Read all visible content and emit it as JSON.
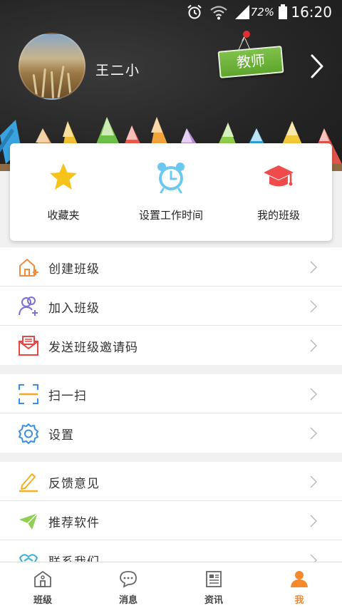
{
  "status_bar": {
    "battery_percent": "72%",
    "time": "16:20"
  },
  "profile": {
    "name": "王二小",
    "role": "教师"
  },
  "quick_actions": [
    {
      "label": "收藏夹",
      "icon": "star-icon",
      "color": "#f7c21a"
    },
    {
      "label": "设置工作时间",
      "icon": "alarm-clock-icon",
      "color": "#6cc8f0"
    },
    {
      "label": "我的班级",
      "icon": "graduation-cap-icon",
      "color": "#f04b4b"
    }
  ],
  "menu_groups": [
    [
      {
        "label": "创建班级",
        "icon": "house-plus-icon"
      },
      {
        "label": "加入班级",
        "icon": "user-plus-icon"
      },
      {
        "label": "发送班级邀请码",
        "icon": "envelope-icon"
      }
    ],
    [
      {
        "label": "扫一扫",
        "icon": "scan-icon"
      },
      {
        "label": "设置",
        "icon": "settings-icon"
      }
    ],
    [
      {
        "label": "反馈意见",
        "icon": "pencil-icon"
      },
      {
        "label": "推荐软件",
        "icon": "paper-plane-icon"
      },
      {
        "label": "联系我们",
        "icon": "handshake-icon"
      }
    ]
  ],
  "tabs": [
    {
      "label": "班级",
      "icon": "school-icon",
      "active": false
    },
    {
      "label": "消息",
      "icon": "chat-bubble-icon",
      "active": false
    },
    {
      "label": "资讯",
      "icon": "news-icon",
      "active": false
    },
    {
      "label": "我",
      "icon": "person-icon",
      "active": true
    }
  ],
  "colors": {
    "accent": "#f5892c",
    "badge_green": "#6cb43a"
  }
}
